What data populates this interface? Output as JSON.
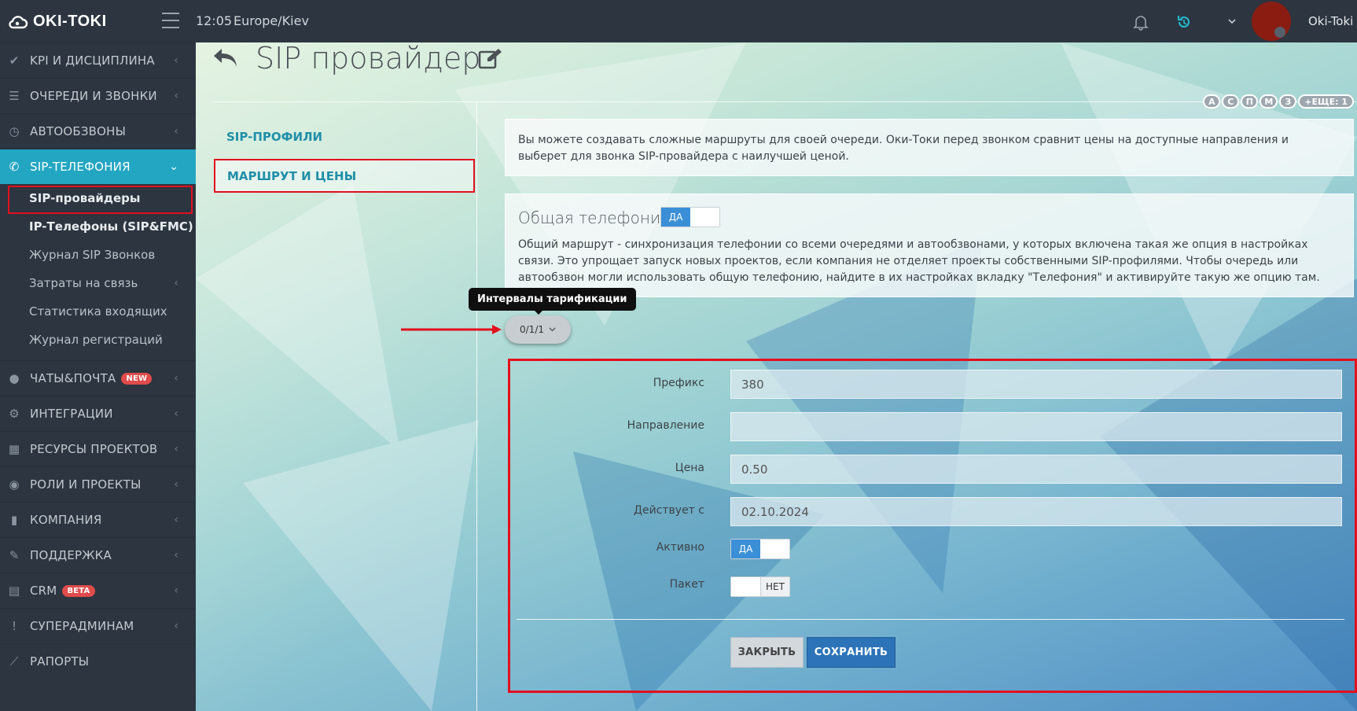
{
  "topbar": {
    "brand": "OKI-TOKI",
    "time": "12:05",
    "timezone": "Europe/Kiev",
    "username": "Oki-Toki",
    "icons": [
      "cloud-logo-icon",
      "hamburger-icon",
      "bell-icon",
      "refresh-icon",
      "chevron-down-icon"
    ]
  },
  "sidebar": {
    "items": [
      {
        "label": "KPI и дисциплина",
        "icon": "check-icon"
      },
      {
        "label": "Очереди и звонки",
        "icon": "list-icon"
      },
      {
        "label": "Автообзвоны",
        "icon": "clock-icon"
      },
      {
        "label": "SIP-телефония",
        "icon": "phone-icon",
        "active": true
      },
      {
        "label": "Чаты&почта",
        "icon": "chat-icon",
        "badge": "NEW"
      },
      {
        "label": "Интеграции",
        "icon": "gears-icon"
      },
      {
        "label": "Ресурсы проектов",
        "icon": "grid-icon"
      },
      {
        "label": "Роли и проекты",
        "icon": "toggle-icon"
      },
      {
        "label": "Компания",
        "icon": "bar-chart-icon"
      },
      {
        "label": "Поддержка",
        "icon": "wrench-icon"
      },
      {
        "label": "CRM",
        "icon": "table-icon",
        "badge": "BETA"
      },
      {
        "label": "Суперадминам",
        "icon": "exclamation-icon"
      },
      {
        "label": "Рапорты",
        "icon": "line-chart-icon"
      }
    ],
    "subitems": [
      {
        "label": "SIP-провайдеры"
      },
      {
        "label": "IP-Телефоны (SIP&FMC)"
      },
      {
        "label": "Журнал SIP Звонков"
      },
      {
        "label": "Затраты на связь"
      },
      {
        "label": "Статистика входящих"
      },
      {
        "label": "Журнал регистраций"
      }
    ]
  },
  "page": {
    "title": "SIP провайдер",
    "chips": [
      "А",
      "С",
      "П",
      "М",
      "З",
      "+ЕЩЕ: 1"
    ],
    "tabs": [
      {
        "label": "SIP-ПРОФИЛИ"
      },
      {
        "label": "МАРШРУТ И ЦЕНЫ"
      }
    ],
    "info_text": "Вы можете создавать сложные маршруты для своей очереди. Оки-Токи перед звонком сравнит цены на доступные направления и выберет для звонка SIP-провайдера с наилучшей ценой.",
    "common": {
      "title": "Общая телефония",
      "toggle_label": "ДА",
      "text": "Общий маршрут - синхронизация телефонии со всеми очередями и автообзвонами, у которых включена такая же опция в настройках связи. Это упрощает запуск новых проектов, если компания не отделяет проекты собственными SIP-профилями. Чтобы очередь или автообзвон могли использовать общую телефонию, найдите в их настройках вкладку \"Телефония\" и активируйте такую же опцию там."
    },
    "tooltip": "Интервалы тарификации",
    "interval": "0/1/1"
  },
  "form": {
    "prefix_label": "Префикс",
    "prefix_value": "380",
    "direction_label": "Направление",
    "direction_value": "",
    "price_label": "Цена",
    "price_value": "0.50",
    "valid_from_label": "Действует с",
    "valid_from_value": "02.10.2024",
    "active_label": "Активно",
    "active_toggle": "ДА",
    "package_label": "Пакет",
    "package_toggle": "НЕТ",
    "close_label": "Закрыть",
    "save_label": "Сохранить"
  },
  "colors": {
    "sidebar_bg": "#2c3540",
    "accent": "#23a6c2",
    "primary_button": "#2c73b8",
    "highlight_border": "#e3101d"
  }
}
